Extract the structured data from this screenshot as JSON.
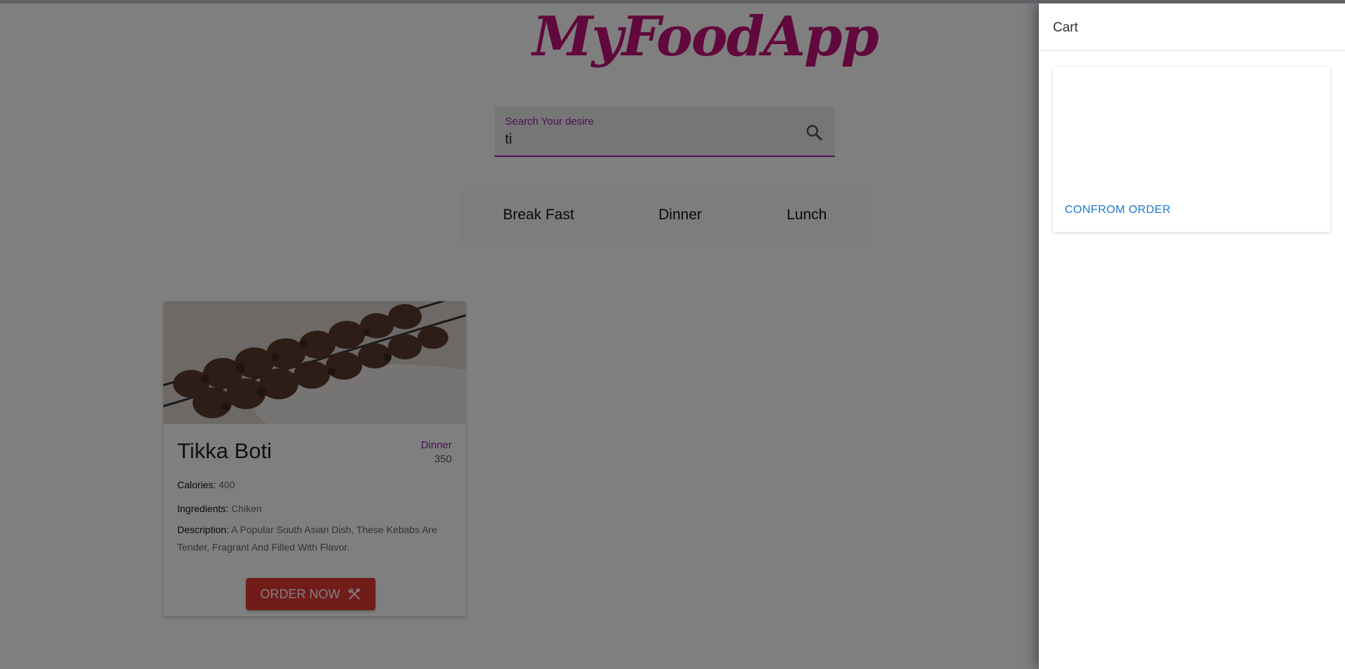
{
  "app": {
    "logo_text": "MyFoodApp",
    "brand_color": "#c2127a"
  },
  "search": {
    "label": "Search Your desire",
    "value": "ti",
    "icon": "search-icon"
  },
  "tabs": [
    {
      "label": "Break Fast"
    },
    {
      "label": "Dinner"
    },
    {
      "label": "Lunch"
    }
  ],
  "food_card": {
    "name": "Tikka Boti",
    "category": "Dinner",
    "price": "350",
    "calories_label": "Calories:",
    "calories_value": "400",
    "ingredients_label": "Ingredients:",
    "ingredients_value": "Chiken",
    "description_label": "Description:",
    "description_value": "A Popular South Asian Dish, These Kebabs Are Tender, Fragrant And Filled With Flavor.",
    "order_button": "ORDER NOW",
    "order_icon": "utensils-icon"
  },
  "cart": {
    "title": "Cart",
    "confirm_button": "CONFROM ORDER"
  },
  "colors": {
    "accent": "#9c27b0",
    "order_button": "#e53935",
    "confirm_link": "#1976d2"
  }
}
